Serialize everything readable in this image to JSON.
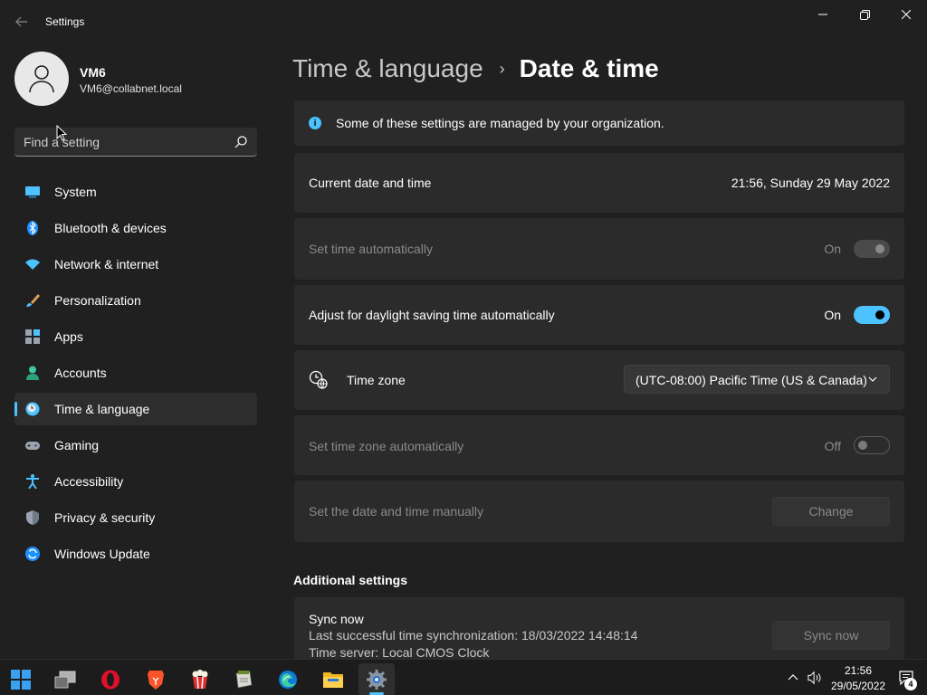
{
  "window": {
    "title": "Settings",
    "controls": [
      "minimize",
      "maximize",
      "close"
    ]
  },
  "user": {
    "name": "VM6",
    "email": "VM6@collabnet.local"
  },
  "search": {
    "placeholder": "Find a setting"
  },
  "sidebar": {
    "items": [
      {
        "label": "System",
        "icon": "monitor-icon"
      },
      {
        "label": "Bluetooth & devices",
        "icon": "bluetooth-icon"
      },
      {
        "label": "Network & internet",
        "icon": "wifi-icon"
      },
      {
        "label": "Personalization",
        "icon": "brush-icon"
      },
      {
        "label": "Apps",
        "icon": "apps-icon"
      },
      {
        "label": "Accounts",
        "icon": "person-icon"
      },
      {
        "label": "Time & language",
        "icon": "clock-globe-icon",
        "active": true
      },
      {
        "label": "Gaming",
        "icon": "gamepad-icon"
      },
      {
        "label": "Accessibility",
        "icon": "accessibility-icon"
      },
      {
        "label": "Privacy & security",
        "icon": "shield-icon"
      },
      {
        "label": "Windows Update",
        "icon": "update-icon"
      }
    ]
  },
  "breadcrumb": {
    "parent": "Time & language",
    "separator": "›",
    "current": "Date & time"
  },
  "main": {
    "info_banner": "Some of these settings are managed by your organization.",
    "current_datetime": {
      "label": "Current date and time",
      "value": "21:56, Sunday 29 May 2022"
    },
    "set_time_auto": {
      "label": "Set time automatically",
      "state_text": "On",
      "state": "on",
      "enabled": false
    },
    "daylight_saving": {
      "label": "Adjust for daylight saving time automatically",
      "state_text": "On",
      "state": "on",
      "enabled": true
    },
    "time_zone": {
      "label": "Time zone",
      "selected": "(UTC-08:00) Pacific Time (US & Canada)"
    },
    "set_tz_auto": {
      "label": "Set time zone automatically",
      "state_text": "Off",
      "state": "off",
      "enabled": false
    },
    "manual": {
      "label": "Set the date and time manually",
      "button": "Change"
    },
    "additional": {
      "title": "Additional settings",
      "sync_title": "Sync now",
      "last_sync": "Last successful time synchronization: 18/03/2022 14:48:14",
      "time_server": "Time server: Local CMOS Clock",
      "sync_button": "Sync now"
    }
  },
  "taskbar": {
    "apps": [
      "start-icon",
      "task-view-icon",
      "opera-icon",
      "brave-icon",
      "popcorn-icon",
      "notepad-icon",
      "edge-icon",
      "file-explorer-icon",
      "settings-icon"
    ],
    "active_app": "settings-icon",
    "time": "21:56",
    "date": "29/05/2022",
    "notification_count": "4"
  },
  "colors": {
    "accent": "#4cc2ff",
    "background": "#202020",
    "card": "#2b2b2b"
  }
}
